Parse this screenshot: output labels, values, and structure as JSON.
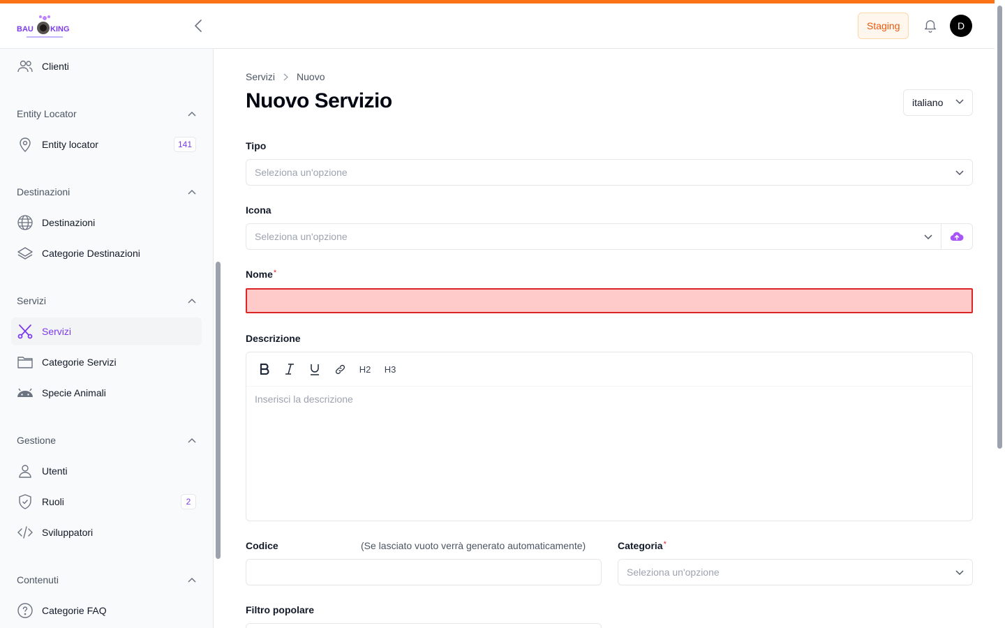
{
  "header": {
    "logo_text": "BAU KING",
    "staging_label": "Staging",
    "avatar_initial": "D"
  },
  "sidebar": {
    "items_top": [
      {
        "label": "Clienti",
        "icon": "users-icon"
      }
    ],
    "groups": [
      {
        "title": "Entity Locator",
        "items": [
          {
            "label": "Entity locator",
            "icon": "map-pin-icon",
            "count": "141"
          }
        ]
      },
      {
        "title": "Destinazioni",
        "items": [
          {
            "label": "Destinazioni",
            "icon": "globe-icon"
          },
          {
            "label": "Categorie Destinazioni",
            "icon": "layers-icon"
          }
        ]
      },
      {
        "title": "Servizi",
        "items": [
          {
            "label": "Servizi",
            "icon": "scissors-icon",
            "active": true
          },
          {
            "label": "Categorie Servizi",
            "icon": "folder-icon"
          },
          {
            "label": "Specie Animali",
            "icon": "android-icon"
          }
        ]
      },
      {
        "title": "Gestione",
        "items": [
          {
            "label": "Utenti",
            "icon": "user-icon"
          },
          {
            "label": "Ruoli",
            "icon": "shield-check-icon",
            "count": "2"
          },
          {
            "label": "Sviluppatori",
            "icon": "code-icon"
          }
        ]
      },
      {
        "title": "Contenuti",
        "items": [
          {
            "label": "Categorie FAQ",
            "icon": "question-circle-icon"
          }
        ]
      }
    ]
  },
  "breadcrumb": {
    "parent": "Servizi",
    "current": "Nuovo"
  },
  "page": {
    "title": "Nuovo Servizio",
    "language": "italiano"
  },
  "form": {
    "tipo": {
      "label": "Tipo",
      "placeholder": "Seleziona un'opzione"
    },
    "icona": {
      "label": "Icona",
      "placeholder": "Seleziona un'opzione"
    },
    "nome": {
      "label": "Nome",
      "required_mark": "*",
      "value": ""
    },
    "descrizione": {
      "label": "Descrizione",
      "placeholder": "Inserisci la descrizione",
      "toolbar": [
        "bold-icon",
        "italic-icon",
        "underline-icon",
        "link-icon",
        "H2",
        "H3"
      ]
    },
    "codice": {
      "label": "Codice",
      "hint": "(Se lasciato vuoto verrà generato automaticamente)",
      "value": ""
    },
    "categoria": {
      "label": "Categoria",
      "required_mark": "*",
      "placeholder": "Seleziona un'opzione"
    },
    "filtro_popolare": {
      "label": "Filtro popolare"
    }
  },
  "colors": {
    "accent": "#f97316",
    "brand": "#7c3aed",
    "error": "#dc2626",
    "error_bg": "#fecaca"
  }
}
